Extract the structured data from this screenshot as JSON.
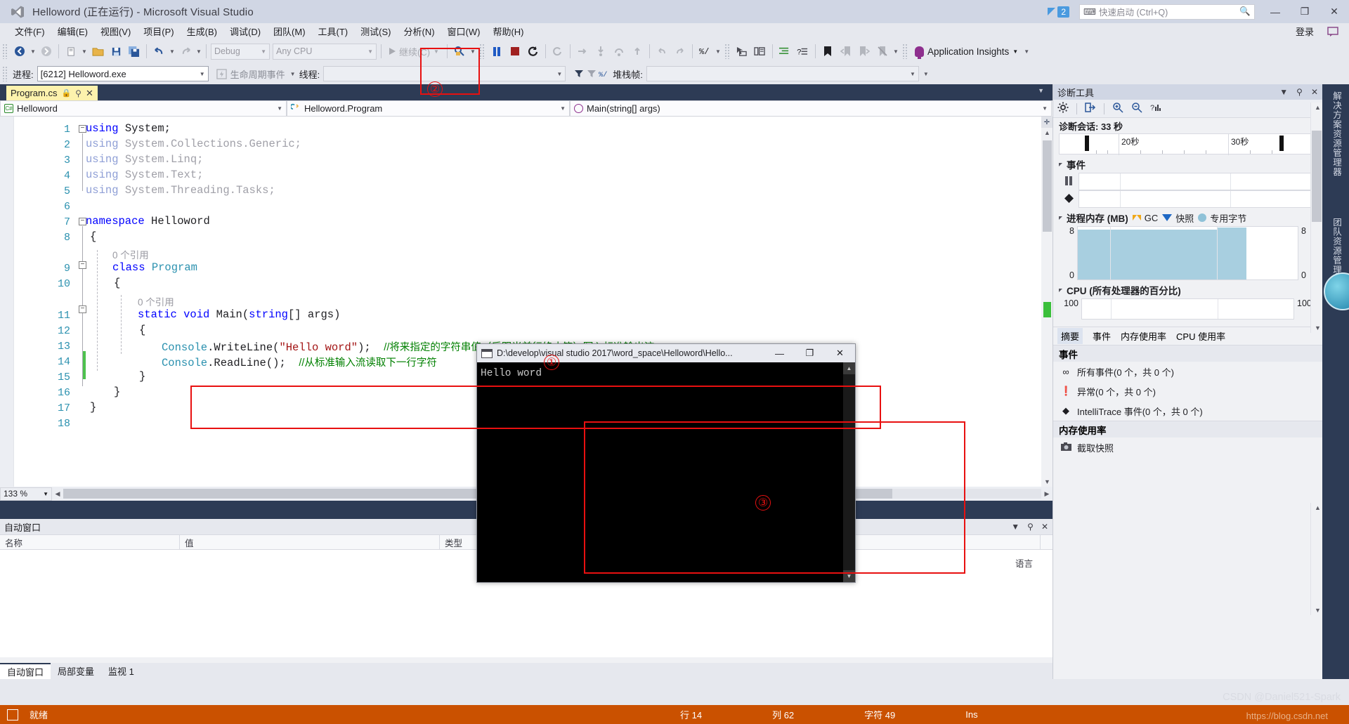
{
  "window": {
    "title": "Helloword (正在运行) - Microsoft Visual Studio",
    "logo_icon": "visual-studio-logo",
    "minimize": "—",
    "maximize": "❐",
    "close": "✕",
    "notification_count": "2",
    "quick_launch_placeholder": "快速启动 (Ctrl+Q)",
    "quick_launch_icon": "search-icon",
    "login_label": "登录"
  },
  "menu": {
    "items": [
      "文件(F)",
      "编辑(E)",
      "视图(V)",
      "项目(P)",
      "生成(B)",
      "调试(D)",
      "团队(M)",
      "工具(T)",
      "测试(S)",
      "分析(N)",
      "窗口(W)",
      "帮助(H)"
    ]
  },
  "toolbar": {
    "configuration": "Debug",
    "platform": "Any CPU",
    "continue_label": "继续(C)",
    "app_insights_label": "Application Insights",
    "icons": [
      "navigate-back-icon",
      "navigate-forward-icon",
      "new-item-icon",
      "open-file-icon",
      "save-icon",
      "save-all-icon",
      "undo-icon",
      "redo-icon"
    ]
  },
  "debugbar": {
    "process_label": "进程:",
    "process_value": "[6212] Helloword.exe",
    "lifecycle_label": "生命周期事件",
    "thread_label": "线程:",
    "thread_value": "",
    "stackframe_label": "堆栈帧:",
    "stackframe_value": ""
  },
  "editor": {
    "tab": {
      "name": "Program.cs",
      "lock_icon": "lock-icon",
      "pin_icon": "pin-icon",
      "close_icon": "close-icon"
    },
    "nav": {
      "project": "Helloword",
      "type": "Helloword.Program",
      "member": "Main(string[] args)"
    },
    "zoom": "133 %",
    "line_numbers": [
      "1",
      "2",
      "3",
      "4",
      "5",
      "6",
      "7",
      "8",
      "9",
      "10",
      "11",
      "12",
      "13",
      "14",
      "15",
      "16",
      "17",
      "18"
    ],
    "lines": [
      {
        "n": 1,
        "text": "using System;"
      },
      {
        "n": 2,
        "text": "using System.Collections.Generic;"
      },
      {
        "n": 3,
        "text": "using System.Linq;"
      },
      {
        "n": 4,
        "text": "using System.Text;"
      },
      {
        "n": 5,
        "text": "using System.Threading.Tasks;"
      },
      {
        "n": 6,
        "text": ""
      },
      {
        "n": 7,
        "text": "namespace Helloword"
      },
      {
        "n": 8,
        "text": "{"
      },
      {
        "n": 9,
        "text": "class Program"
      },
      {
        "n": 10,
        "text": "{"
      },
      {
        "n": 11,
        "text": "static void Main(string[] args)"
      },
      {
        "n": 12,
        "text": "{"
      },
      {
        "n": 13,
        "text": "Console.WriteLine(\"Hello word\");  //将来指定的字符串值（后跟当前行终止符）写入标准输出流"
      },
      {
        "n": 14,
        "text": "Console.ReadLine();  //从标准输入流读取下一行字符"
      },
      {
        "n": 15,
        "text": "}"
      },
      {
        "n": 16,
        "text": "}"
      },
      {
        "n": 17,
        "text": "}"
      },
      {
        "n": 18,
        "text": ""
      }
    ],
    "code": {
      "using_kw": "using",
      "l1_ns": "System;",
      "l2_ns": "System.Collections.Generic;",
      "l3_ns": "System.Linq;",
      "l4_ns": "System.Text;",
      "l5_ns": "System.Threading.Tasks;",
      "namespace_kw": "namespace",
      "namespace_name": "Helloword",
      "brace_open": "{",
      "brace_close": "}",
      "class_kw": "class",
      "class_name": "Program",
      "static_kw": "static",
      "void_kw": "void",
      "main_name": "Main(",
      "string_kw": "string",
      "main_args": "[] args)",
      "console": "Console",
      "writeline": ".WriteLine(",
      "hello_string": "\"Hello word\"",
      "writeline_end": ");",
      "writeline_comment": "//将来指定的字符串值（后跟当前行终止符）写入标准输出流",
      "readline": ".ReadLine();",
      "readline_comment": "//从标准输入流读取下一行字符",
      "ref_hint": "0 个引用"
    }
  },
  "autos": {
    "title": "自动窗口",
    "columns": [
      "名称",
      "值",
      "类型"
    ],
    "right_column": "语言",
    "tabs": [
      {
        "label": "自动窗口",
        "selected": true
      },
      {
        "label": "局部变量",
        "selected": false
      },
      {
        "label": "监视 1",
        "selected": false
      }
    ]
  },
  "diagnostics": {
    "title": "诊断工具",
    "toolbar_icons": [
      "gear-icon",
      "export-icon",
      "zoom-in-icon",
      "zoom-out-icon",
      "chart-icon"
    ],
    "session_label": "诊断会话: 33 秒",
    "ruler_labels": [
      "20秒",
      "30秒"
    ],
    "events_section": "事件",
    "event_row_icons": [
      "pause-icon",
      "diamond-icon"
    ],
    "memory_section": "进程内存 (MB)",
    "memory_legend": [
      {
        "label": "GC",
        "icon": "gc-marker"
      },
      {
        "label": "快照",
        "icon": "snapshot-marker"
      },
      {
        "label": "专用字节",
        "icon": "private-bytes-dot"
      }
    ],
    "memory_axis": {
      "max": "8",
      "min": "0"
    },
    "cpu_section": "CPU (所有处理器的百分比)",
    "cpu_axis": {
      "max": "100"
    },
    "tabs": [
      {
        "label": "摘要",
        "selected": true
      },
      {
        "label": "事件",
        "selected": false
      },
      {
        "label": "内存使用率",
        "selected": false
      },
      {
        "label": "CPU 使用率",
        "selected": false
      }
    ],
    "events_header": "事件",
    "event_items": [
      {
        "glyph": "∞",
        "label": "所有事件(0 个，共 0 个)",
        "color": "#3c3c44"
      },
      {
        "glyph": "❗",
        "label": "异常(0 个，共 0 个)",
        "color": "#d08000"
      },
      {
        "glyph": "◆",
        "label": "IntelliTrace 事件(0 个，共 0 个)",
        "color": "#1e1e22"
      }
    ],
    "memory_usage_header": "内存使用率",
    "snapshot_action": "截取快照"
  },
  "vertical_dock": {
    "labels": [
      "解决方案资源管理器",
      "团队资源管理器"
    ]
  },
  "console": {
    "title": "D:\\develop\\visual studio 2017\\word_space\\Helloword\\Hello...",
    "output": "Hello word",
    "minimize": "—",
    "maximize": "❐",
    "close": "✕"
  },
  "annotations": [
    {
      "num": "①"
    },
    {
      "num": "②"
    },
    {
      "num": "③"
    }
  ],
  "statusbar": {
    "state": "就绪",
    "line_label": "行 14",
    "col_label": "列 62",
    "char_label": "字符 49",
    "ins_label": "Ins"
  },
  "watermark": {
    "main": "CSDN @Daniel521-Spark",
    "sub": "https://blog.csdn.net"
  },
  "colors": {
    "accent": "#2d3b55",
    "status_bar": "#ca5100",
    "annotation_red": "#e81010",
    "keyword_blue": "#0000ff",
    "type_teal": "#2b91af",
    "string_red": "#a31515",
    "comment_green": "#008000",
    "tab_yellow": "#fdf2ad",
    "memory_fill": "#a8cfe0"
  }
}
